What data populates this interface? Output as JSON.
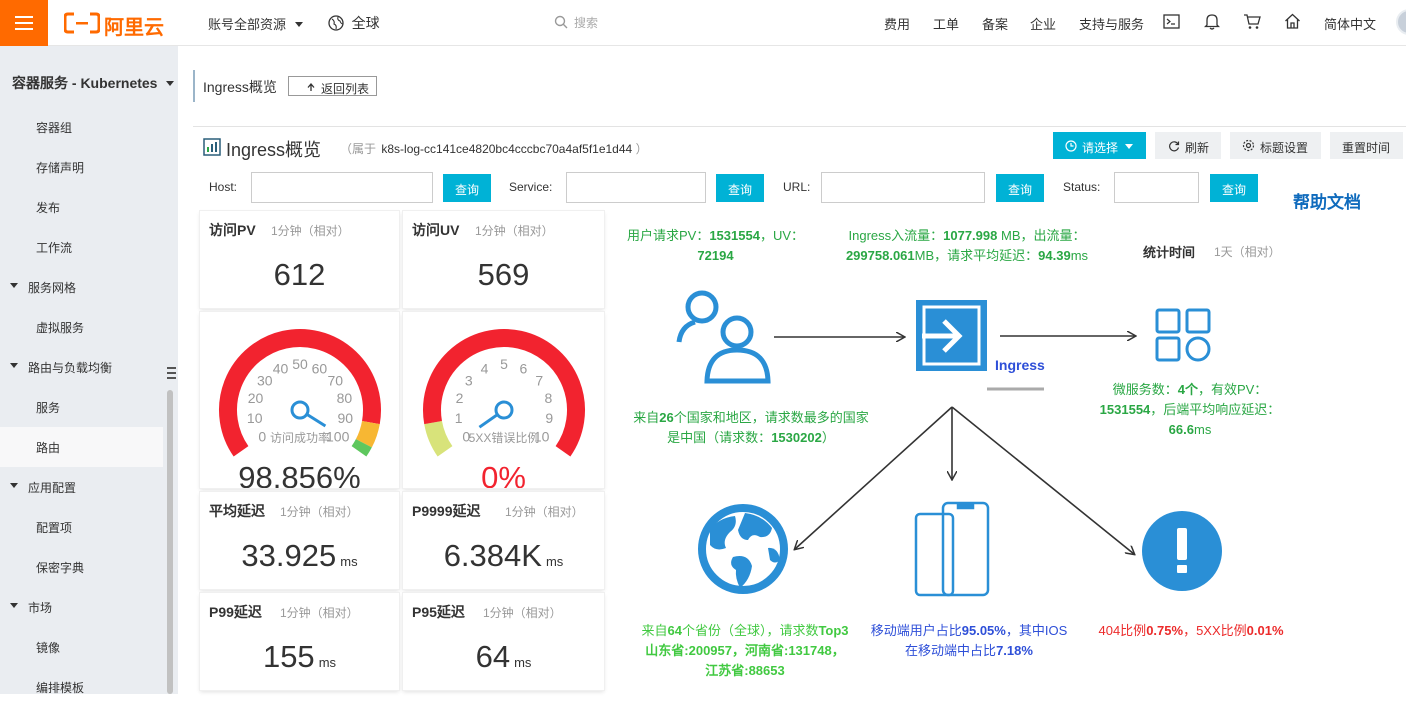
{
  "topbar": {
    "logo": "阿里云",
    "account_resources": "账号全部资源",
    "region": "全球",
    "search_placeholder": "搜索",
    "nav": [
      "费用",
      "工单",
      "备案",
      "企业",
      "支持与服务"
    ],
    "language": "简体中文"
  },
  "sidebar": {
    "title": "容器服务 - Kubernetes",
    "items": [
      {
        "label": "容器组",
        "group": false
      },
      {
        "label": "存储声明",
        "group": false
      },
      {
        "label": "发布",
        "group": false
      },
      {
        "label": "工作流",
        "group": false
      },
      {
        "label": "服务网格",
        "group": true
      },
      {
        "label": "虚拟服务",
        "group": false
      },
      {
        "label": "路由与负载均衡",
        "group": true
      },
      {
        "label": "服务",
        "group": false
      },
      {
        "label": "路由",
        "group": false,
        "active": true
      },
      {
        "label": "应用配置",
        "group": true
      },
      {
        "label": "配置项",
        "group": false
      },
      {
        "label": "保密字典",
        "group": false
      },
      {
        "label": "市场",
        "group": true
      },
      {
        "label": "镜像",
        "group": false
      },
      {
        "label": "编排模板",
        "group": false
      }
    ]
  },
  "header": {
    "breadcrumb_title": "Ingress概览",
    "back_button": "返回列表",
    "dashboard_title": "Ingress概览",
    "belongs_prefix": "（属于",
    "project": "k8s-log-cc141ce4820bc4cccbc70a4af5f1e1d44",
    "belongs_suffix": "）",
    "select_button": "请选择",
    "refresh_button": "刷新",
    "title_settings_button": "标题设置",
    "reset_time_button": "重置时间"
  },
  "filters": [
    {
      "label": "Host:",
      "value": "",
      "button": "查询"
    },
    {
      "label": "Service:",
      "value": "",
      "button": "查询"
    },
    {
      "label": "URL:",
      "value": "",
      "button": "查询"
    },
    {
      "label": "Status:",
      "value": "",
      "button": "查询"
    }
  ],
  "help_doc": "帮助文档",
  "cards": {
    "pv": {
      "title": "访问PV",
      "range": "1分钟（相对）",
      "value": "612"
    },
    "uv": {
      "title": "访问UV",
      "range": "1分钟（相对）",
      "value": "569"
    },
    "success_rate": {
      "label": "访问成功率",
      "value": "98.856%",
      "level": 0.98856,
      "ticks": [
        "0",
        "10",
        "20",
        "30",
        "40",
        "50",
        "60",
        "70",
        "80",
        "90",
        "100"
      ]
    },
    "error_rate": {
      "label": "5XX错误比例",
      "value": "0%",
      "level": 0,
      "ticks": [
        "0",
        "1",
        "2",
        "3",
        "4",
        "5",
        "6",
        "7",
        "8",
        "9",
        "10"
      ]
    },
    "avg_latency": {
      "title": "平均延迟",
      "range": "1分钟（相对）",
      "value": "33.925",
      "unit": "ms"
    },
    "p9999": {
      "title": "P9999延迟",
      "range": "1分钟（相对）",
      "value": "6.384K",
      "unit": "ms"
    },
    "p99": {
      "title": "P99延迟",
      "range": "1分钟（相对）",
      "value": "155",
      "unit": "ms"
    },
    "p95": {
      "title": "P95延迟",
      "range": "1分钟（相对）",
      "value": "64",
      "unit": "ms"
    }
  },
  "flow": {
    "user_text": {
      "a": "用户请求PV：",
      "pv": "1531554",
      "b": "，UV：",
      "uv": "72194"
    },
    "ingress_text": {
      "a": "Ingress入流量：",
      "in": "1077.998",
      "b": " MB，出流量：",
      "out": "299758.061",
      "c": "MB，请求平均延迟：",
      "lat": "94.39",
      "d": "ms"
    },
    "stat_time_label": "统计时间",
    "stat_time_value": "1天（相对）",
    "ingress_label": "Ingress",
    "country_text": {
      "a": "来自",
      "n": "26",
      "b": "个国家和地区，请求数最多的国家是中国（请求数：",
      "c": "1530202",
      "d": "）"
    },
    "micro_text": {
      "a": "微服务数：",
      "n": "4个",
      "b": "，有效PV：",
      "pv": "1531554",
      "c": "，后端平均响应延迟：",
      "lat": "66.6",
      "d": "ms"
    },
    "province_text": {
      "a": "来自",
      "n": "64",
      "b": "个省份（全球），请求数",
      "c": "Top3 山东省:200957，河南省:131748，江苏省:88653"
    },
    "mobile_text": {
      "a": "移动端用户占比",
      "p": "95.05%",
      "b": "，其中IOS在移动端中占比",
      "ios": "7.18%"
    },
    "error_text": {
      "a": "404比例",
      "p404": "0.75%",
      "b": "，5XX比例",
      "p5xx": "0.01%"
    }
  },
  "colors": {
    "brand": "#ff6a00",
    "accent": "#00b2d6",
    "icon_blue": "#2a8fd6",
    "gauge_red": "#f2232f",
    "green_text": "#2aa744",
    "blue_text": "#2e4fd8",
    "red_text": "#ec2a2a"
  }
}
